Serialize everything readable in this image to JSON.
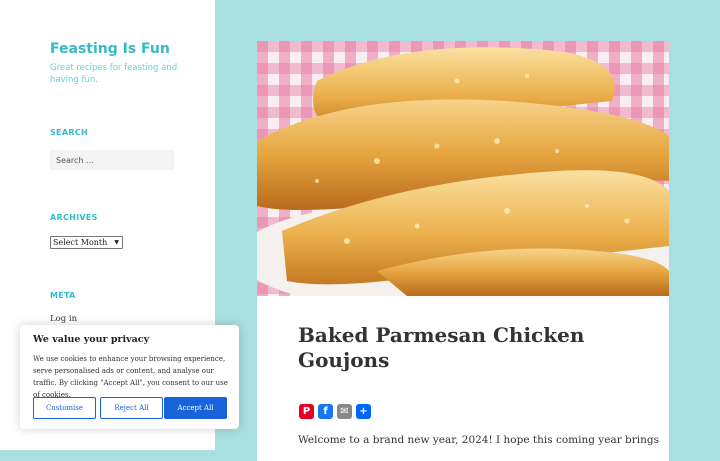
{
  "site": {
    "title": "Feasting Is Fun",
    "description": "Great recipes for feasting and having fun."
  },
  "sidebar": {
    "search": {
      "heading": "SEARCH",
      "placeholder": "Search …"
    },
    "archives": {
      "heading": "ARCHIVES",
      "selected": "Select Month"
    },
    "meta": {
      "heading": "META",
      "links": [
        "Log in"
      ]
    }
  },
  "post": {
    "title": "Baked Parmesan Chicken Goujons",
    "excerpt": "Welcome to a brand new year, 2024! I hope this coming year brings",
    "share_icons": [
      {
        "name": "pinterest-icon",
        "color": "#e60023",
        "glyph": "P"
      },
      {
        "name": "facebook-icon",
        "color": "#1877f2",
        "glyph": "f"
      },
      {
        "name": "email-icon",
        "color": "#888888",
        "glyph": "✉"
      },
      {
        "name": "share-icon",
        "color": "#0166ff",
        "glyph": "+"
      }
    ]
  },
  "cookie_banner": {
    "title": "We value your privacy",
    "text": "We use cookies to enhance your browsing experience, serve personalised ads or content, and analyse our traffic. By clicking \"Accept All\", you consent to our use of cookies.",
    "buttons": {
      "customise": "Customise",
      "reject": "Reject All",
      "accept": "Accept All"
    }
  },
  "colors": {
    "background": "#a9dfe0",
    "accent": "#33bcc7",
    "button_blue": "#1863dc"
  }
}
